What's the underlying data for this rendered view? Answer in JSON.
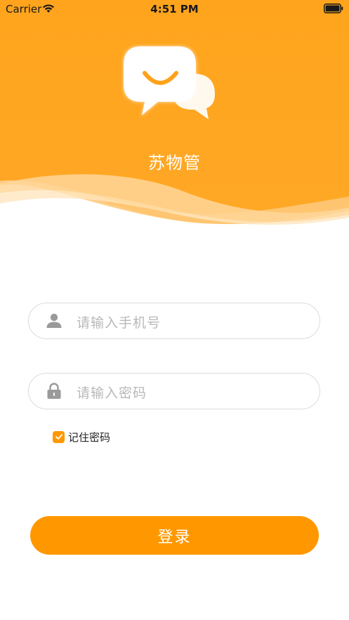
{
  "status_bar": {
    "carrier": "Carrier",
    "time": "4:51 PM"
  },
  "header": {
    "app_name": "苏物管",
    "logo_icon": "chat-bubbles-icon",
    "bg_color": "#ffa21a"
  },
  "form": {
    "phone": {
      "icon": "user-icon",
      "placeholder": "请输入手机号"
    },
    "password": {
      "icon": "lock-icon",
      "placeholder": "请输入密码"
    },
    "remember": {
      "label": "记住密码",
      "checked": true
    },
    "login_label": "登录"
  },
  "colors": {
    "accent": "#ff9800",
    "placeholder": "#b8b8b8",
    "border": "#dcdcdc"
  }
}
